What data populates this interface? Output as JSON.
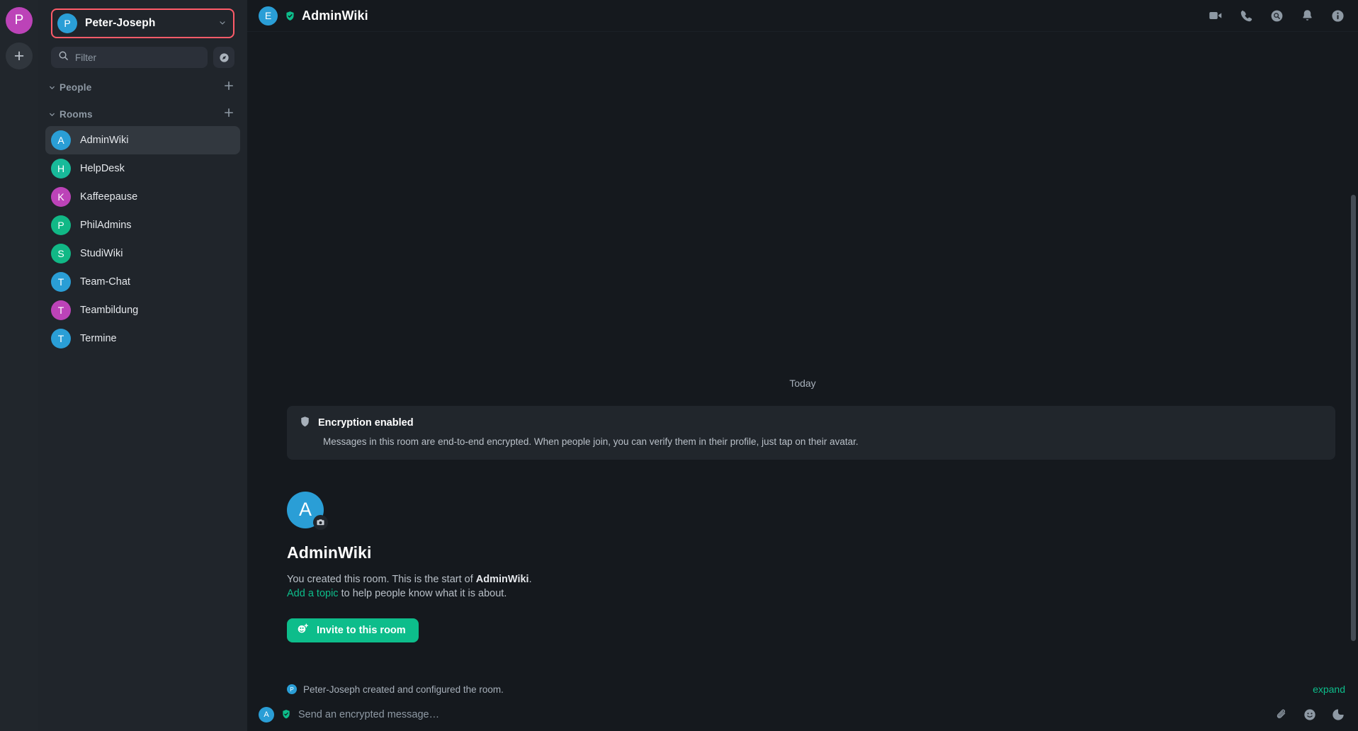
{
  "spaces": {
    "home_avatar_letter": "P",
    "home_avatar_color": "#bc43b8",
    "add_space_label": "+"
  },
  "user_menu": {
    "avatar_letter": "P",
    "avatar_color": "#2a9ed6",
    "name": "Peter-Joseph",
    "chevron": "⌄",
    "focus_outline_color": "#ff5b69"
  },
  "search": {
    "placeholder": "Filter",
    "icon": "search-icon",
    "explore_icon": "explore-public-rooms-icon"
  },
  "sections": [
    {
      "id": "people",
      "label": "People",
      "collapse_icon": "chevron-down-icon",
      "add_icon": "plus-icon",
      "rooms": []
    },
    {
      "id": "rooms",
      "label": "Rooms",
      "collapse_icon": "chevron-down-icon",
      "add_icon": "plus-icon",
      "rooms": [
        {
          "name": "AdminWiki",
          "letter": "A",
          "color": "#2a9ed6",
          "selected": true
        },
        {
          "name": "HelpDesk",
          "letter": "H",
          "color": "#18ba9a",
          "selected": false
        },
        {
          "name": "Kaffeepause",
          "letter": "K",
          "color": "#bc43b8",
          "selected": false
        },
        {
          "name": "PhilAdmins",
          "letter": "P",
          "color": "#11b886",
          "selected": false
        },
        {
          "name": "StudiWiki",
          "letter": "S",
          "color": "#11b886",
          "selected": false
        },
        {
          "name": "Team-Chat",
          "letter": "T",
          "color": "#2a9ed6",
          "selected": false
        },
        {
          "name": "Teambildung",
          "letter": "T",
          "color": "#bc43b8",
          "selected": false
        },
        {
          "name": "Termine",
          "letter": "T",
          "color": "#2a9ed6",
          "selected": false
        }
      ]
    }
  ],
  "room_header": {
    "avatar_letter": "E",
    "avatar_color": "#2a9ed6",
    "verified_icon": "verified-shield-icon",
    "title": "AdminWiki",
    "icons": [
      {
        "name": "video-call-icon",
        "label": "Video call"
      },
      {
        "name": "voice-call-icon",
        "label": "Voice call"
      },
      {
        "name": "threads-icon",
        "label": "Threads"
      },
      {
        "name": "notifications-icon",
        "label": "Notifications"
      },
      {
        "name": "room-info-icon",
        "label": "Room info"
      }
    ]
  },
  "timeline": {
    "date_separator": "Today",
    "encryption": {
      "icon": "shield-icon",
      "title": "Encryption enabled",
      "body": "Messages in this room are end-to-end encrypted. When people join, you can verify them in their profile, just tap on their avatar."
    },
    "intro": {
      "avatar_letter": "A",
      "avatar_color": "#2a9ed6",
      "camera_icon": "camera-icon",
      "room_name": "AdminWiki",
      "line1_prefix": "You created this room. This is the start of ",
      "line1_room": "AdminWiki",
      "line1_suffix": ".",
      "topic_link": "Add a topic",
      "line2_suffix": " to help people know what it is about.",
      "invite_button": "Invite to this room",
      "invite_icon": "invite-user-icon",
      "invite_color": "#0dbd8b"
    },
    "event": {
      "avatar_letter": "P",
      "avatar_color": "#2a9ed6",
      "text": "Peter-Joseph created and configured the room.",
      "expand_label": "expand"
    }
  },
  "composer": {
    "avatar_letter": "A",
    "avatar_color": "#2a9ed6",
    "shield_icon": "encrypted-shield-icon",
    "placeholder": "Send an encrypted message…",
    "icons": [
      {
        "name": "attachment-icon",
        "label": "Attachment"
      },
      {
        "name": "emoji-icon",
        "label": "Emoji"
      },
      {
        "name": "sticker-icon",
        "label": "Sticker"
      }
    ]
  }
}
